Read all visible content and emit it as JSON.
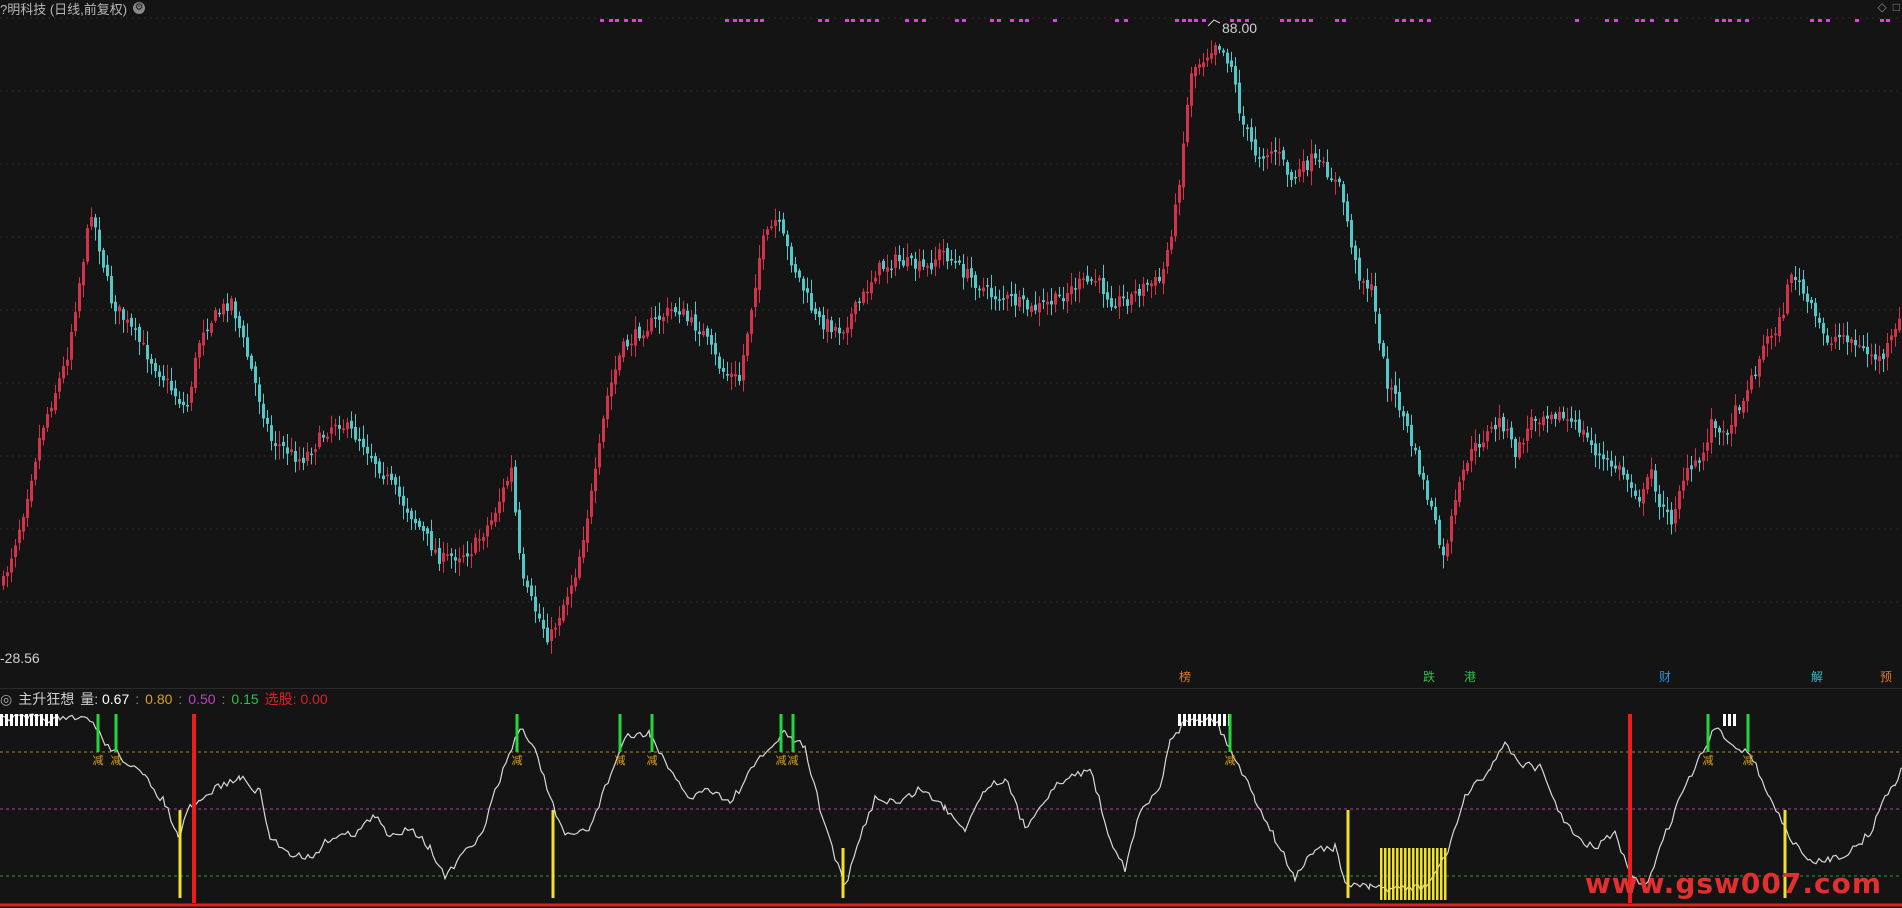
{
  "window": {
    "title": "?明科技 (日线,前复权)",
    "settings_icon": "gear-icon",
    "corner_icons": [
      "diamond-icon",
      "window-icon"
    ]
  },
  "price_chart": {
    "high_label": "88.00",
    "low_label": "-28.56",
    "up_color": "#d2324a",
    "down_color": "#54c8c8",
    "signal_color": "#e040e0"
  },
  "events": [
    {
      "text": "榜",
      "color": "#e07a2a"
    },
    {
      "text": "跌",
      "color": "#2fbf4a"
    },
    {
      "text": "港",
      "color": "#2fbf4a"
    },
    {
      "text": "财",
      "color": "#3a8ae0"
    },
    {
      "text": "解",
      "color": "#3fb8c8"
    },
    {
      "text": "预",
      "color": "#e07a2a"
    }
  ],
  "indicator": {
    "name": "主升狂想",
    "fields": [
      {
        "label": "量:",
        "value": "0.67",
        "color": "#ffffff"
      },
      {
        "label": "",
        "value": "0.80",
        "color": "#d8a020"
      },
      {
        "label": "",
        "value": "0.50",
        "color": "#c040c0"
      },
      {
        "label": "",
        "value": "0.15",
        "color": "#2fbf4a"
      },
      {
        "label": "选股:",
        "value": "0.00",
        "color": "#e02020"
      }
    ],
    "separator": ":",
    "signal_label": "减",
    "levels": {
      "upper": 0.8,
      "middle": 0.5,
      "lower": 0.15
    },
    "line_color": "#d8d8d8"
  },
  "watermark": "www.gsw007.com"
}
